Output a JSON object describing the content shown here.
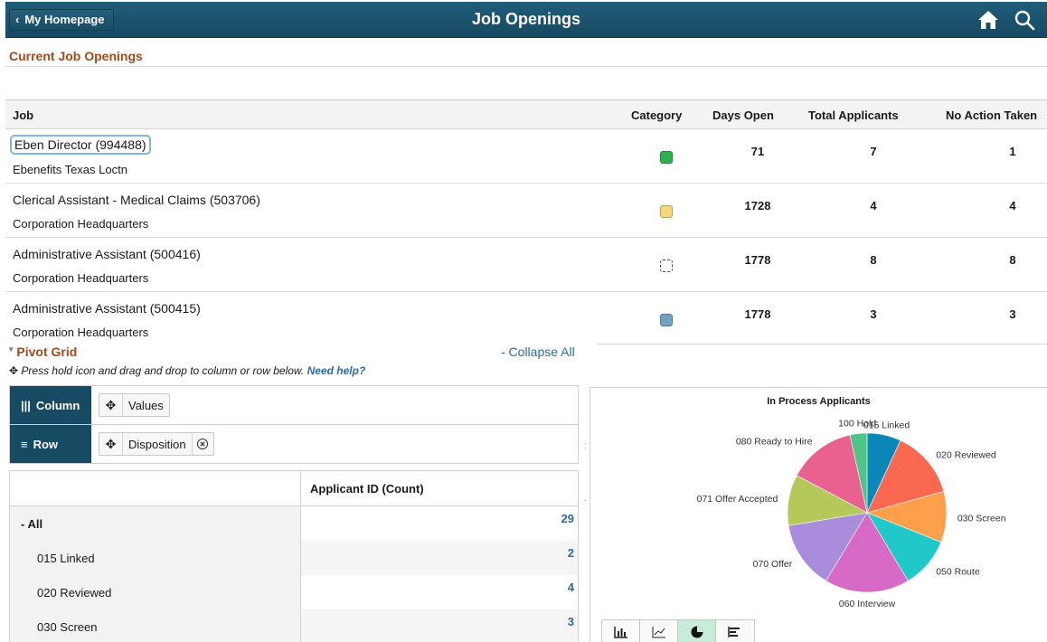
{
  "header": {
    "back_label": "My Homepage",
    "title": "Job Openings"
  },
  "section_title": "Current Job Openings",
  "table": {
    "columns": {
      "job": "Job",
      "category": "Category",
      "days_open": "Days Open",
      "total_applicants": "Total Applicants",
      "no_action": "No Action Taken"
    },
    "rows": [
      {
        "job": "Eben Director (994488)",
        "location": "Ebenefits Texas Loctn",
        "category_color": "#2bb24c",
        "days_open": "71",
        "total_applicants": "7",
        "no_action": "1"
      },
      {
        "job": "Clerical Assistant - Medical Claims (503706)",
        "location": "Corporation Headquarters",
        "category_color": "#f6d77a",
        "days_open": "1728",
        "total_applicants": "4",
        "no_action": "4"
      },
      {
        "job": "Administrative Assistant (500416)",
        "location": "Corporation Headquarters",
        "category_color": "#ffffff",
        "days_open": "1778",
        "total_applicants": "8",
        "no_action": "8"
      },
      {
        "job": "Administrative Assistant (500415)",
        "location": "Corporation Headquarters",
        "category_color": "#6fa3c4",
        "days_open": "1778",
        "total_applicants": "3",
        "no_action": "3"
      }
    ]
  },
  "pivot": {
    "title": "Pivot Grid",
    "collapse_label": "- Collapse All",
    "hint": "Press hold icon and drag and drop to column or row below.",
    "help_link": "Need help?",
    "column_label": "Column",
    "row_label": "Row",
    "column_chip": "Values",
    "row_chip": "Disposition",
    "grid_header": "Applicant ID (Count)",
    "rows": [
      {
        "label": "- All",
        "value": "29"
      },
      {
        "label": "015 Linked",
        "value": "2"
      },
      {
        "label": "020 Reviewed",
        "value": "4"
      },
      {
        "label": "030 Screen",
        "value": "3"
      }
    ]
  },
  "chart_data": {
    "type": "pie",
    "title": "In Process Applicants",
    "labels": [
      "015 Linked",
      "020 Reviewed",
      "030 Screen",
      "050 Route",
      "060 Interview",
      "070 Offer",
      "071 Offer Accepted",
      "080 Ready to Hire",
      "100 Hold"
    ],
    "values": [
      2,
      4,
      3,
      3,
      5,
      4,
      3,
      4,
      1
    ],
    "colors": [
      "#0a86b8",
      "#f9684f",
      "#fda04c",
      "#20c8c9",
      "#d66ac6",
      "#a98cdc",
      "#b5c95b",
      "#e9628f",
      "#4fc487"
    ]
  },
  "chart_toolbar": [
    "bar-chart-icon",
    "line-chart-icon",
    "pie-chart-icon",
    "horizontal-bar-icon"
  ]
}
